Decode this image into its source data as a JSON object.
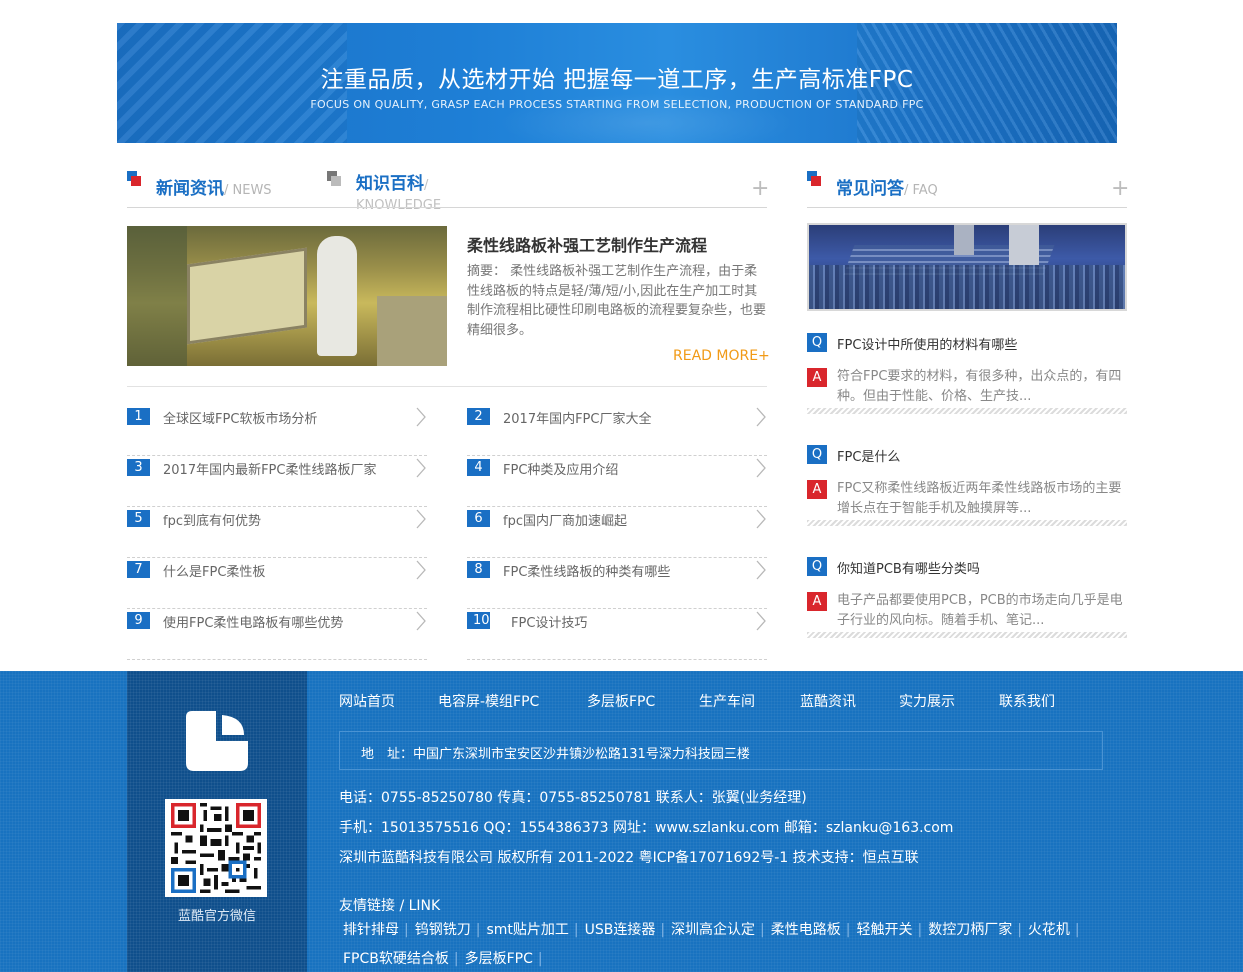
{
  "banner": {
    "title": "注重品质，从选材开始 把握每一道工序，生产高标准FPC",
    "subtitle": "FOCUS ON QUALITY, GRASP EACH PROCESS STARTING FROM SELECTION, PRODUCTION OF STANDARD FPC"
  },
  "news_section": {
    "tab1_cn": "新闻资讯",
    "tab1_en": "/ NEWS",
    "tab2_cn": "知识百科",
    "tab2_en": "/ KNOWLEDGE",
    "more_symbol": "+",
    "featured": {
      "title": "柔性线路板补强工艺制作生产流程",
      "summary": "摘要： 柔性线路板补强工艺制作生产流程，由于柔性线路板的特点是轻/薄/短/小,因此在生产加工时其制作流程相比硬性印刷电路板的流程要复杂些，也要精细很多。",
      "read_more": "READ MORE+"
    },
    "items": [
      {
        "num": "1",
        "text": "全球区域FPC软板市场分析"
      },
      {
        "num": "2",
        "text": "2017年国内FPC厂家大全"
      },
      {
        "num": "3",
        "text": "2017年国内最新FPC柔性线路板厂家"
      },
      {
        "num": "4",
        "text": "FPC种类及应用介绍"
      },
      {
        "num": "5",
        "text": "fpc到底有何优势"
      },
      {
        "num": "6",
        "text": "fpc国内厂商加速崛起"
      },
      {
        "num": "7",
        "text": "什么是FPC柔性板"
      },
      {
        "num": "8",
        "text": "FPC柔性线路板的种类有哪些"
      },
      {
        "num": "9",
        "text": "使用FPC柔性电路板有哪些优势"
      },
      {
        "num": "10",
        "text": "FPC设计技巧"
      }
    ]
  },
  "faq_section": {
    "title_cn": "常见问答",
    "title_en": "/ FAQ",
    "more_symbol": "+",
    "q_badge": "Q",
    "a_badge": "A",
    "items": [
      {
        "q": "FPC设计中所使用的材料有哪些",
        "a": "符合FPC要求的材料，有很多种，出众点的，有四种。但由于性能、价格、生产技..."
      },
      {
        "q": "FPC是什么",
        "a": "FPC又称柔性线路板近两年柔性线路板市场的主要增长点在于智能手机及触摸屏等..."
      },
      {
        "q": "你知道PCB有哪些分类吗",
        "a": "电子产品都要使用PCB，PCB的市场走向几乎是电子行业的风向标。随着手机、笔记..."
      }
    ]
  },
  "footer": {
    "qr_caption": "蓝酷官方微信",
    "nav": [
      "网站首页",
      "电容屏-模组FPC",
      "多层板FPC",
      "生产车间",
      "蓝酷资讯",
      "实力展示",
      "联系我们"
    ],
    "address": "地　址：中国广东深圳市宝安区沙井镇沙松路131号深力科技园三楼",
    "contact_line1": "电话：0755-85250780   传真：0755-85250781   联系人：张翼(业务经理)",
    "contact_line2": "手机：15013575516   QQ：1554386373   网址：www.szlanku.com   邮箱：szlanku@163.com",
    "copyright": "深圳市蓝酷科技有限公司 版权所有 2011-2022 粤ICP备17071692号-1 技术支持：恒点互联",
    "links_title": "友情链接 / LINK",
    "links": [
      "排针排母",
      "钨钢铣刀",
      "smt贴片加工",
      "USB连接器",
      "深圳高企认定",
      "柔性电路板",
      "轻触开关",
      "数控刀柄厂家",
      "火花机",
      "FPCB软硬结合板",
      "多层板FPC"
    ],
    "link_separator": "|"
  },
  "colors": {
    "brand_blue": "#1a6fc4",
    "accent_red": "#d9262c",
    "read_more_orange": "#f19a16",
    "footer_blue": "#1872c0"
  }
}
